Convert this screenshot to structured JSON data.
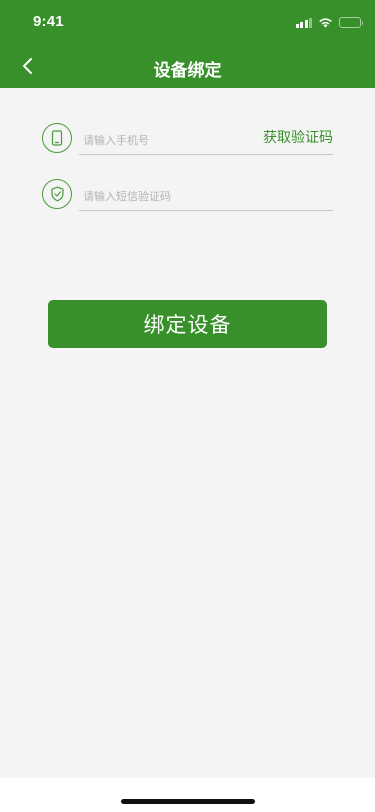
{
  "status_bar": {
    "time": "9:41",
    "icons": [
      "signal-icon",
      "wifi-icon",
      "battery-icon"
    ]
  },
  "nav": {
    "title": "设备绑定",
    "back_icon": "chevron-left-icon"
  },
  "form": {
    "phone": {
      "icon": "phone-icon",
      "placeholder": "请输入手机号",
      "value": "",
      "action_label": "获取验证码"
    },
    "code": {
      "icon": "shield-check-icon",
      "placeholder": "请输入短信验证码",
      "value": ""
    }
  },
  "bind_button": {
    "label": "绑定设备"
  },
  "colors": {
    "accent": "#38902a",
    "background": "#f4f4f4",
    "placeholder": "#b4b4b4",
    "divider": "#c8c8c8"
  }
}
